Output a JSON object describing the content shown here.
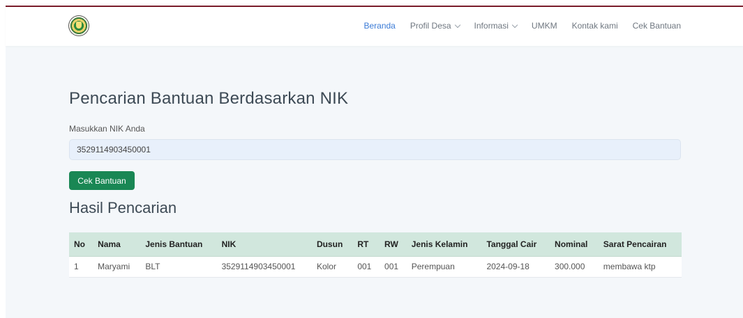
{
  "nav": {
    "items": [
      {
        "label": "Beranda",
        "active": true,
        "dropdown": false
      },
      {
        "label": "Profil Desa",
        "active": false,
        "dropdown": true
      },
      {
        "label": "Informasi",
        "active": false,
        "dropdown": true
      },
      {
        "label": "UMKM",
        "active": false,
        "dropdown": false
      },
      {
        "label": "Kontak kami",
        "active": false,
        "dropdown": false
      },
      {
        "label": "Cek Bantuan",
        "active": false,
        "dropdown": false
      }
    ]
  },
  "search": {
    "title": "Pencarian Bantuan Berdasarkan NIK",
    "label": "Masukkan NIK Anda",
    "value": "3529114903450001",
    "button_label": "Cek Bantuan"
  },
  "results": {
    "title": "Hasil Pencarian",
    "columns": [
      "No",
      "Nama",
      "Jenis Bantuan",
      "NIK",
      "Dusun",
      "RT",
      "RW",
      "Jenis Kelamin",
      "Tanggal Cair",
      "Nominal",
      "Sarat Pencairan"
    ],
    "rows": [
      [
        "1",
        "Maryami",
        "BLT",
        "3529114903450001",
        "Kolor",
        "001",
        "001",
        "Perempuan",
        "2024-09-18",
        "300.000",
        "membawa ktp"
      ]
    ]
  },
  "colors": {
    "accent": "#3b7bd6",
    "button": "#198754",
    "table_header": "#d1e7dd",
    "top_border": "#7a1c2a"
  }
}
